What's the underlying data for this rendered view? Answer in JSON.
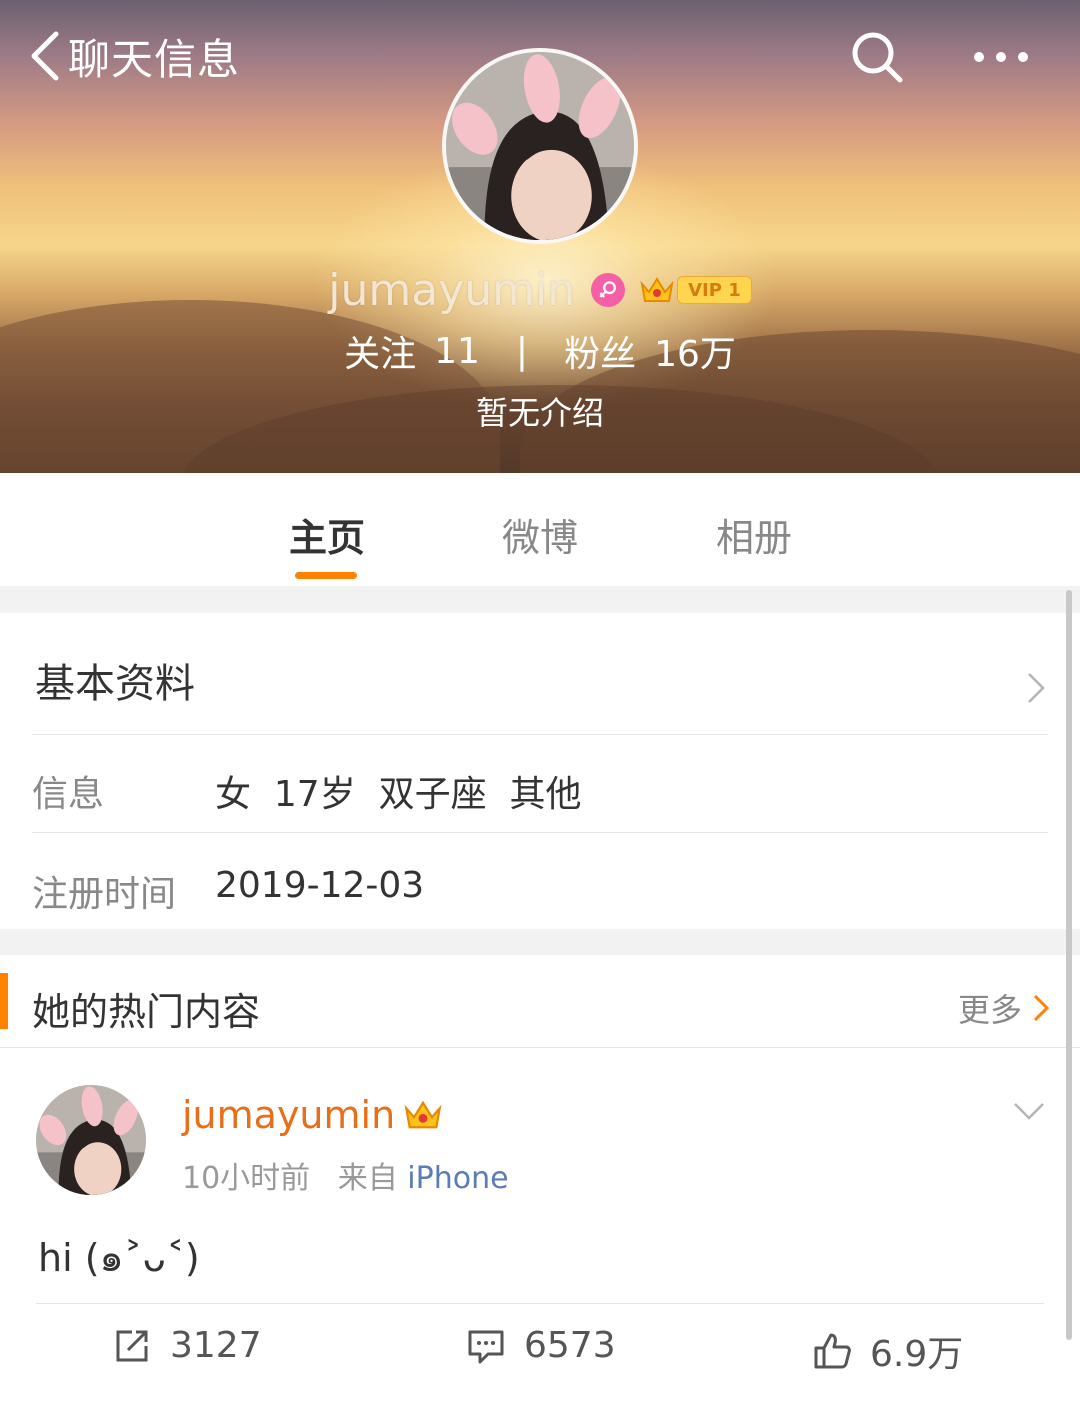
{
  "header": {
    "back_label": "聊天信息",
    "username": "jumayumin",
    "vip_label": "VIP 1",
    "stats": {
      "following_label": "关注",
      "following_count": "11",
      "separator": "|",
      "followers_label": "粉丝",
      "followers_count": "16万"
    },
    "intro": "暂无介绍"
  },
  "tabs": [
    {
      "label": "主页",
      "active": true
    },
    {
      "label": "微博",
      "active": false
    },
    {
      "label": "相册",
      "active": false
    }
  ],
  "basic_info": {
    "title": "基本资料",
    "rows": [
      {
        "label": "信息",
        "value": "女  17岁  双子座  其他"
      },
      {
        "label": "注册时间",
        "value": "2019-12-03"
      }
    ]
  },
  "hot_content": {
    "title": "她的热门内容",
    "more_label": "更多",
    "post": {
      "author": "jumayumin",
      "time": "10小时前",
      "source_prefix": "来自",
      "source": "iPhone",
      "text": "hi (๑˃ᴗ˂)",
      "reposts": "3127",
      "comments": "6573",
      "likes": "6.9万"
    }
  },
  "colors": {
    "accent": "#ff8200",
    "author_name": "#e86f1a",
    "source_link": "#5c7cb4",
    "female_badge": "#f45fa6"
  },
  "icons": [
    "back-arrow-icon",
    "search-icon",
    "more-icon",
    "female-icon",
    "crown-icon",
    "chevron-right-icon",
    "chevron-down-icon",
    "repost-icon",
    "comment-icon",
    "like-icon"
  ]
}
